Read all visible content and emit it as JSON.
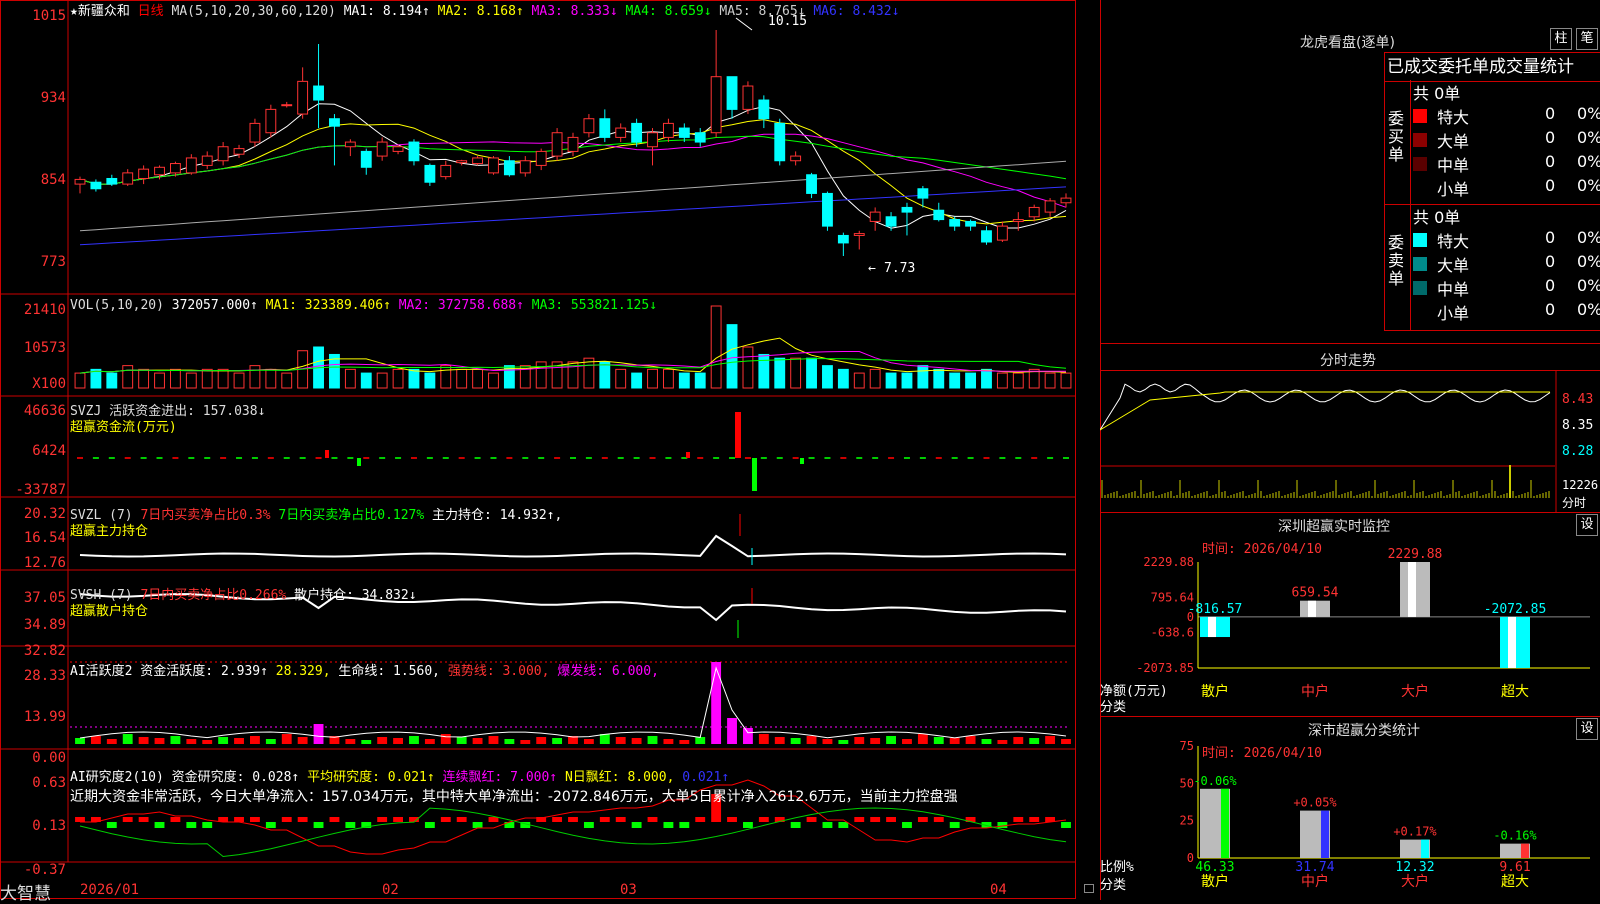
{
  "stock": {
    "name": "★新疆众和",
    "period": "日线"
  },
  "ma_line": {
    "label": "MA(5,10,20,30,60,120)",
    "items": [
      {
        "text": "MA1: 8.194↑",
        "color": "#ffffff"
      },
      {
        "text": "MA2: 8.168↑",
        "color": "#ffff00"
      },
      {
        "text": "MA3: 8.333↓",
        "color": "#ff00ff"
      },
      {
        "text": "MA4: 8.659↓",
        "color": "#00ff00"
      },
      {
        "text": "MA5: 8.765↓",
        "color": "#cccccc"
      },
      {
        "text": "MA6: 8.432↓",
        "color": "#3333ff"
      }
    ]
  },
  "price_axis": [
    "1015",
    "934",
    "854",
    "773"
  ],
  "high_label": "10.15",
  "low_label": "7.73",
  "vol": {
    "label": "VOL(5,10,20)",
    "value": "372057.000↑",
    "ma1": "MA1: 323389.406↑",
    "ma2": "MA2: 372758.688↑",
    "ma3": "MA3: 553821.125↓",
    "axis": [
      "21410",
      "10573",
      "X100"
    ]
  },
  "svzj": {
    "label": "SVZJ  活跃资金进出: 157.038↓",
    "sub": "超赢资金流(万元)",
    "axis": [
      "46636",
      "6424",
      "-33787"
    ]
  },
  "svzl": {
    "label": "SVZL (7)",
    "t1": "7日内买卖净占比0.3%",
    "t2": "7日内买卖净占比0.127%",
    "t3": "主力持仓: 14.932↑,",
    "sub": "超赢主力持仓",
    "axis": [
      "20.32",
      "16.54",
      "12.76"
    ]
  },
  "svsh": {
    "label": "SVSH (7)",
    "t1": "7日内买卖净占比0.266%",
    "t2": "散户持仓: 34.832↓",
    "sub": "超赢散户持仓",
    "axis": [
      "37.05",
      "34.89",
      "32.82"
    ]
  },
  "ai1": {
    "label": "AI活跃度2 资金活跃度: 2.939↑",
    "v2": "28.329,",
    "v3": "生命线: 1.560,",
    "v4": "强势线: 3.000,",
    "v5": "爆发线: 6.000,",
    "axis": [
      "28.33",
      "13.99",
      "0.00"
    ]
  },
  "ai2": {
    "label": "AI研究度2(10) 资金研究度: 0.028↑",
    "v2": "平均研究度: 0.021↑",
    "v3": "连续飘红: 7.000↑",
    "v4": "N日飘红: 8.000,",
    "v5": "0.021↑",
    "note": "近期大资金非常活跃，今日大单净流入：157.034万元，其中特大单净流出：-2072.846万元，大单5日累计净入2612.6万元，当前主力控盘强",
    "axis": [
      "0.63",
      "0.13",
      "-0.37"
    ]
  },
  "dates": [
    "2026/01",
    "02",
    "03",
    "04"
  ],
  "brand": "大智慧",
  "right": {
    "title": "龙虎看盘(逐单)",
    "btn_column": "柱",
    "btn_pen": "笔",
    "header": "已成交委托单成交量统计",
    "buy": {
      "side_label": "委买单",
      "total": "共 0单",
      "rows": [
        {
          "label": "特大",
          "count": "0",
          "pct": "0%",
          "color": "#ff0000"
        },
        {
          "label": "大单",
          "count": "0",
          "pct": "0%",
          "color": "#8b0000"
        },
        {
          "label": "中单",
          "count": "0",
          "pct": "0%",
          "color": "#5a0000"
        },
        {
          "label": "小单",
          "count": "0",
          "pct": "0%",
          "color": ""
        }
      ]
    },
    "sell": {
      "side_label": "委卖单",
      "total": "共 0单",
      "rows": [
        {
          "label": "特大",
          "count": "0",
          "pct": "0%",
          "color": "#00ffff"
        },
        {
          "label": "大单",
          "count": "0",
          "pct": "0%",
          "color": "#008b8b"
        },
        {
          "label": "中单",
          "count": "0",
          "pct": "0%",
          "color": "#006a6a"
        },
        {
          "label": "小单",
          "count": "0",
          "pct": "0%",
          "color": ""
        }
      ]
    },
    "intraday": {
      "title": "分时走势",
      "axis": [
        "8.43",
        "8.35",
        "8.28"
      ],
      "vol_axis": [
        "12226",
        "分时"
      ]
    },
    "monitor": {
      "title": "深圳超赢实时监控",
      "btn": "设",
      "time": "时间: 2026/04/10",
      "axis": [
        "2229.88",
        "795.64",
        "0",
        "-638.6",
        "-2073.85"
      ],
      "ylabel1": "净额(万元)",
      "ylabel2": "分类",
      "bars": [
        {
          "cat": "散户",
          "value": -816.57,
          "label": "-816.57"
        },
        {
          "cat": "中户",
          "value": 659.54,
          "label": "659.54"
        },
        {
          "cat": "大户",
          "value": 2229.88,
          "label": "2229.88"
        },
        {
          "cat": "超大",
          "value": -2072.85,
          "label": "-2072.85"
        }
      ]
    },
    "classify": {
      "title": "深市超赢分类统计",
      "btn": "设",
      "time": "时间: 2026/04/10",
      "axis": [
        "75",
        "50",
        "25",
        "0"
      ],
      "ylabel1": "比例%",
      "ylabel2": "分类",
      "bars": [
        {
          "cat": "散户",
          "value": 46.33,
          "label": "46.33",
          "change": "-0.06%"
        },
        {
          "cat": "中户",
          "value": 31.74,
          "label": "31.74",
          "change": "+0.05%"
        },
        {
          "cat": "大户",
          "value": 12.32,
          "label": "12.32",
          "change": "+0.17%"
        },
        {
          "cat": "超大",
          "value": 9.61,
          "label": "9.61",
          "change": "-0.16%"
        }
      ]
    }
  },
  "chart_data": {
    "type": "candlestick",
    "y_range": [
      7.73,
      10.15
    ],
    "candles": [
      [
        8.5,
        8.55,
        8.4,
        8.58
      ],
      [
        8.52,
        8.45,
        8.42,
        8.55
      ],
      [
        8.56,
        8.5,
        8.48,
        8.6
      ],
      [
        8.5,
        8.62,
        8.48,
        8.66
      ],
      [
        8.56,
        8.66,
        8.5,
        8.7
      ],
      [
        8.6,
        8.68,
        8.55,
        8.7
      ],
      [
        8.62,
        8.72,
        8.58,
        8.74
      ],
      [
        8.62,
        8.78,
        8.6,
        8.82
      ],
      [
        8.7,
        8.8,
        8.66,
        8.85
      ],
      [
        8.75,
        8.9,
        8.7,
        8.95
      ],
      [
        8.82,
        8.88,
        8.78,
        8.92
      ],
      [
        8.95,
        9.15,
        8.9,
        9.2
      ],
      [
        9.05,
        9.3,
        9.0,
        9.35
      ],
      [
        9.35,
        9.35,
        9.32,
        9.38
      ],
      [
        9.25,
        9.6,
        9.2,
        9.75
      ],
      [
        9.55,
        9.4,
        9.1,
        10.0
      ],
      [
        9.2,
        9.12,
        8.7,
        9.25
      ],
      [
        8.9,
        8.95,
        8.8,
        8.98
      ],
      [
        8.85,
        8.68,
        8.6,
        8.88
      ],
      [
        8.8,
        8.95,
        8.75,
        9.0
      ],
      [
        8.85,
        8.9,
        8.82,
        8.92
      ],
      [
        8.95,
        8.75,
        8.7,
        8.98
      ],
      [
        8.7,
        8.52,
        8.48,
        8.72
      ],
      [
        8.58,
        8.7,
        8.55,
        8.75
      ],
      [
        8.73,
        8.75,
        8.7,
        8.76
      ],
      [
        8.72,
        8.78,
        8.7,
        8.8
      ],
      [
        8.62,
        8.78,
        8.6,
        8.8
      ],
      [
        8.75,
        8.6,
        8.58,
        8.8
      ],
      [
        8.62,
        8.75,
        8.58,
        8.8
      ],
      [
        8.7,
        8.85,
        8.65,
        8.88
      ],
      [
        8.8,
        9.05,
        8.75,
        9.1
      ],
      [
        8.85,
        9.0,
        8.8,
        9.05
      ],
      [
        9.05,
        9.2,
        9.0,
        9.25
      ],
      [
        9.2,
        9.0,
        8.95,
        9.3
      ],
      [
        9.0,
        9.1,
        8.95,
        9.15
      ],
      [
        9.15,
        8.95,
        8.9,
        9.2
      ],
      [
        8.9,
        9.05,
        8.7,
        9.1
      ],
      [
        9.0,
        9.15,
        8.95,
        9.2
      ],
      [
        9.1,
        9.0,
        8.95,
        9.15
      ],
      [
        9.05,
        8.95,
        8.9,
        9.1
      ],
      [
        9.05,
        9.65,
        9.0,
        10.15
      ],
      [
        9.65,
        9.3,
        9.2,
        9.65
      ],
      [
        9.3,
        9.55,
        9.25,
        9.6
      ],
      [
        9.4,
        9.2,
        9.1,
        9.45
      ],
      [
        9.15,
        8.75,
        8.7,
        9.2
      ],
      [
        8.75,
        8.8,
        8.7,
        8.85
      ],
      [
        8.6,
        8.4,
        8.35,
        8.62
      ],
      [
        8.4,
        8.05,
        8.0,
        8.42
      ],
      [
        7.95,
        7.87,
        7.73,
        7.98
      ],
      [
        7.95,
        7.97,
        7.8,
        8.0
      ],
      [
        8.1,
        8.2,
        8.0,
        8.25
      ],
      [
        8.15,
        8.05,
        8.0,
        8.2
      ],
      [
        8.25,
        8.2,
        7.95,
        8.3
      ],
      [
        8.45,
        8.35,
        8.25,
        8.48
      ],
      [
        8.22,
        8.12,
        8.1,
        8.3
      ],
      [
        8.12,
        8.05,
        8.0,
        8.15
      ],
      [
        8.1,
        8.05,
        8.0,
        8.12
      ],
      [
        8.0,
        7.88,
        7.85,
        8.05
      ],
      [
        7.9,
        8.05,
        7.88,
        8.1
      ],
      [
        8.1,
        8.12,
        8.0,
        8.2
      ],
      [
        8.15,
        8.25,
        8.1,
        8.28
      ],
      [
        8.2,
        8.32,
        8.15,
        8.35
      ],
      [
        8.3,
        8.35,
        8.25,
        8.4
      ]
    ],
    "volume": [
      4,
      5,
      4,
      6,
      5,
      4,
      5,
      4,
      5,
      5,
      4,
      6,
      5,
      4,
      10,
      11,
      9,
      5,
      4,
      4,
      5,
      5,
      4,
      6,
      5,
      5,
      4,
      6,
      6,
      7,
      7,
      7,
      8,
      7,
      5,
      4,
      5,
      5,
      4,
      4,
      22,
      17,
      11,
      9,
      8,
      8,
      8,
      6,
      5,
      4,
      5,
      4,
      4,
      6,
      5,
      4,
      4,
      5,
      4,
      4,
      5,
      4,
      4
    ]
  }
}
